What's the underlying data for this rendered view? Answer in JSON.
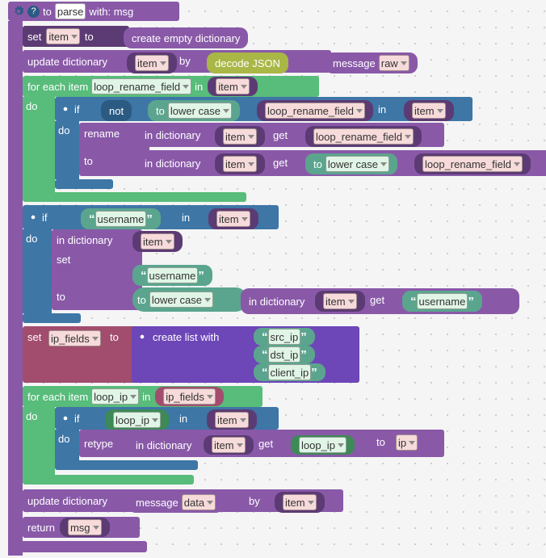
{
  "hdr": {
    "to": "to",
    "parse": "parse",
    "with": "with: msg",
    "q": "?"
  },
  "l1": {
    "set": "set",
    "item": "item",
    "to": "to",
    "create": "create empty dictionary"
  },
  "l2": {
    "upd": "update dictionary",
    "item": "item",
    "by": "by",
    "dec": "decode JSON",
    "msg": "message",
    "raw": "raw"
  },
  "l3": {
    "fe": "for each item",
    "lrf": "loop_rename_field",
    "in": "in",
    "item": "item"
  },
  "do": "do",
  "l4": {
    "if": "if",
    "not": "not",
    "to": "to",
    "lc": "lower case",
    "lrf": "loop_rename_field",
    "in": "in",
    "item": "item"
  },
  "l5": {
    "ren": "rename",
    "ind": "in dictionary",
    "item": "item",
    "get": "get",
    "lrf": "loop_rename_field"
  },
  "l6": {
    "to": "to",
    "ind": "in dictionary",
    "item": "item",
    "get": "get",
    "tolc": "to",
    "lc": "lower case",
    "lrf": "loop_rename_field"
  },
  "l7": {
    "if": "if",
    "un": "username",
    "in": "in",
    "item": "item"
  },
  "l8": {
    "ind": "in dictionary",
    "item": "item",
    "set": "set",
    "un": "username",
    "to": "to",
    "tolc": "to",
    "lc": "lower case",
    "ind2": "in dictionary",
    "item2": "item",
    "get": "get",
    "un2": "username"
  },
  "l9": {
    "set": "set",
    "ipf": "ip_fields",
    "to": "to",
    "clw": "create list with",
    "a": "src_ip",
    "b": "dst_ip",
    "c": "client_ip"
  },
  "l10": {
    "fe": "for each item",
    "lip": "loop_ip",
    "in": "in",
    "ipf": "ip_fields"
  },
  "l11": {
    "if": "if",
    "lip": "loop_ip",
    "in": "in",
    "item": "item"
  },
  "l12": {
    "ret": "retype",
    "ind": "in dictionary",
    "item": "item",
    "get": "get",
    "lip": "loop_ip",
    "to": "to",
    "ip": "ip"
  },
  "l13": {
    "upd": "update dictionary",
    "msg": "message",
    "data": "data",
    "by": "by",
    "item": "item"
  },
  "l14": {
    "ret": "return",
    "msg": "msg"
  }
}
